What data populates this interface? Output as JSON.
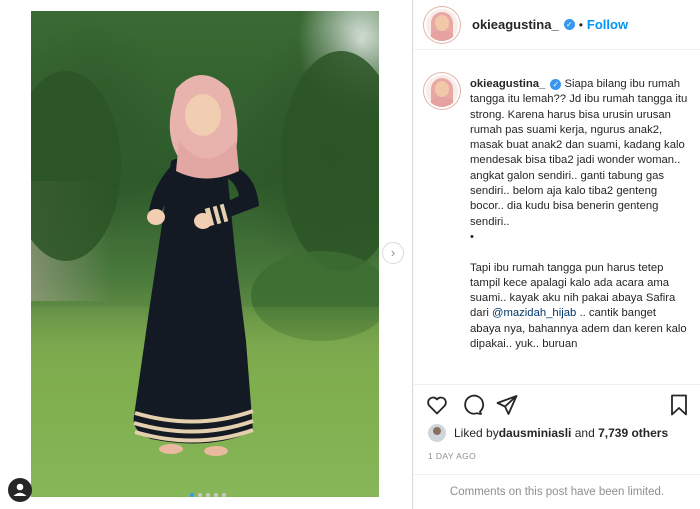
{
  "post": {
    "username": "okieagustina_",
    "verified_glyph": "✓",
    "separator": "•",
    "follow_label": "Follow",
    "carousel_next_glyph": "›",
    "carousel_dots": 5,
    "carousel_active_index": 0
  },
  "caption": {
    "username": "okieagustina_",
    "text_part1": " Siapa bilang ibu rumah tangga itu lemah?? Jd ibu rumah tangga itu strong. Karena harus bisa urusin urusan rumah pas suami kerja, ngurus anak2, masak buat anak2 dan suami, kadang kalo mendesak bisa tiba2 jadi wonder woman.. angkat galon sendiri.. ganti tabung gas sendiri.. belom aja kalo tiba2 genteng bocor.. dia kudu bisa benerin genteng sendiri..\n•\n\nTapi ibu rumah tangga pun harus tetep tampil kece apalagi kalo ada acara ama suami.. kayak aku nih pakai abaya Safira dari ",
    "mention": "@mazidah_hijab",
    "text_part2": " .. cantik banget abaya nya, bahannya adem dan keren kalo dipakai.. yuk.. buruan"
  },
  "actions": {
    "like_icon": "heart-icon",
    "comment_icon": "comment-icon",
    "share_icon": "share-icon",
    "save_icon": "bookmark-icon"
  },
  "likes": {
    "prefix": "Liked by ",
    "user": "dausminiasli",
    "middle": " and ",
    "count": "7,739 others"
  },
  "timestamp": "1 DAY AGO",
  "comments_notice": "Comments on this post have been limited.",
  "colors": {
    "accent": "#0095f6",
    "verified": "#3897f0",
    "muted": "#8e8e8e",
    "text": "#262626"
  }
}
